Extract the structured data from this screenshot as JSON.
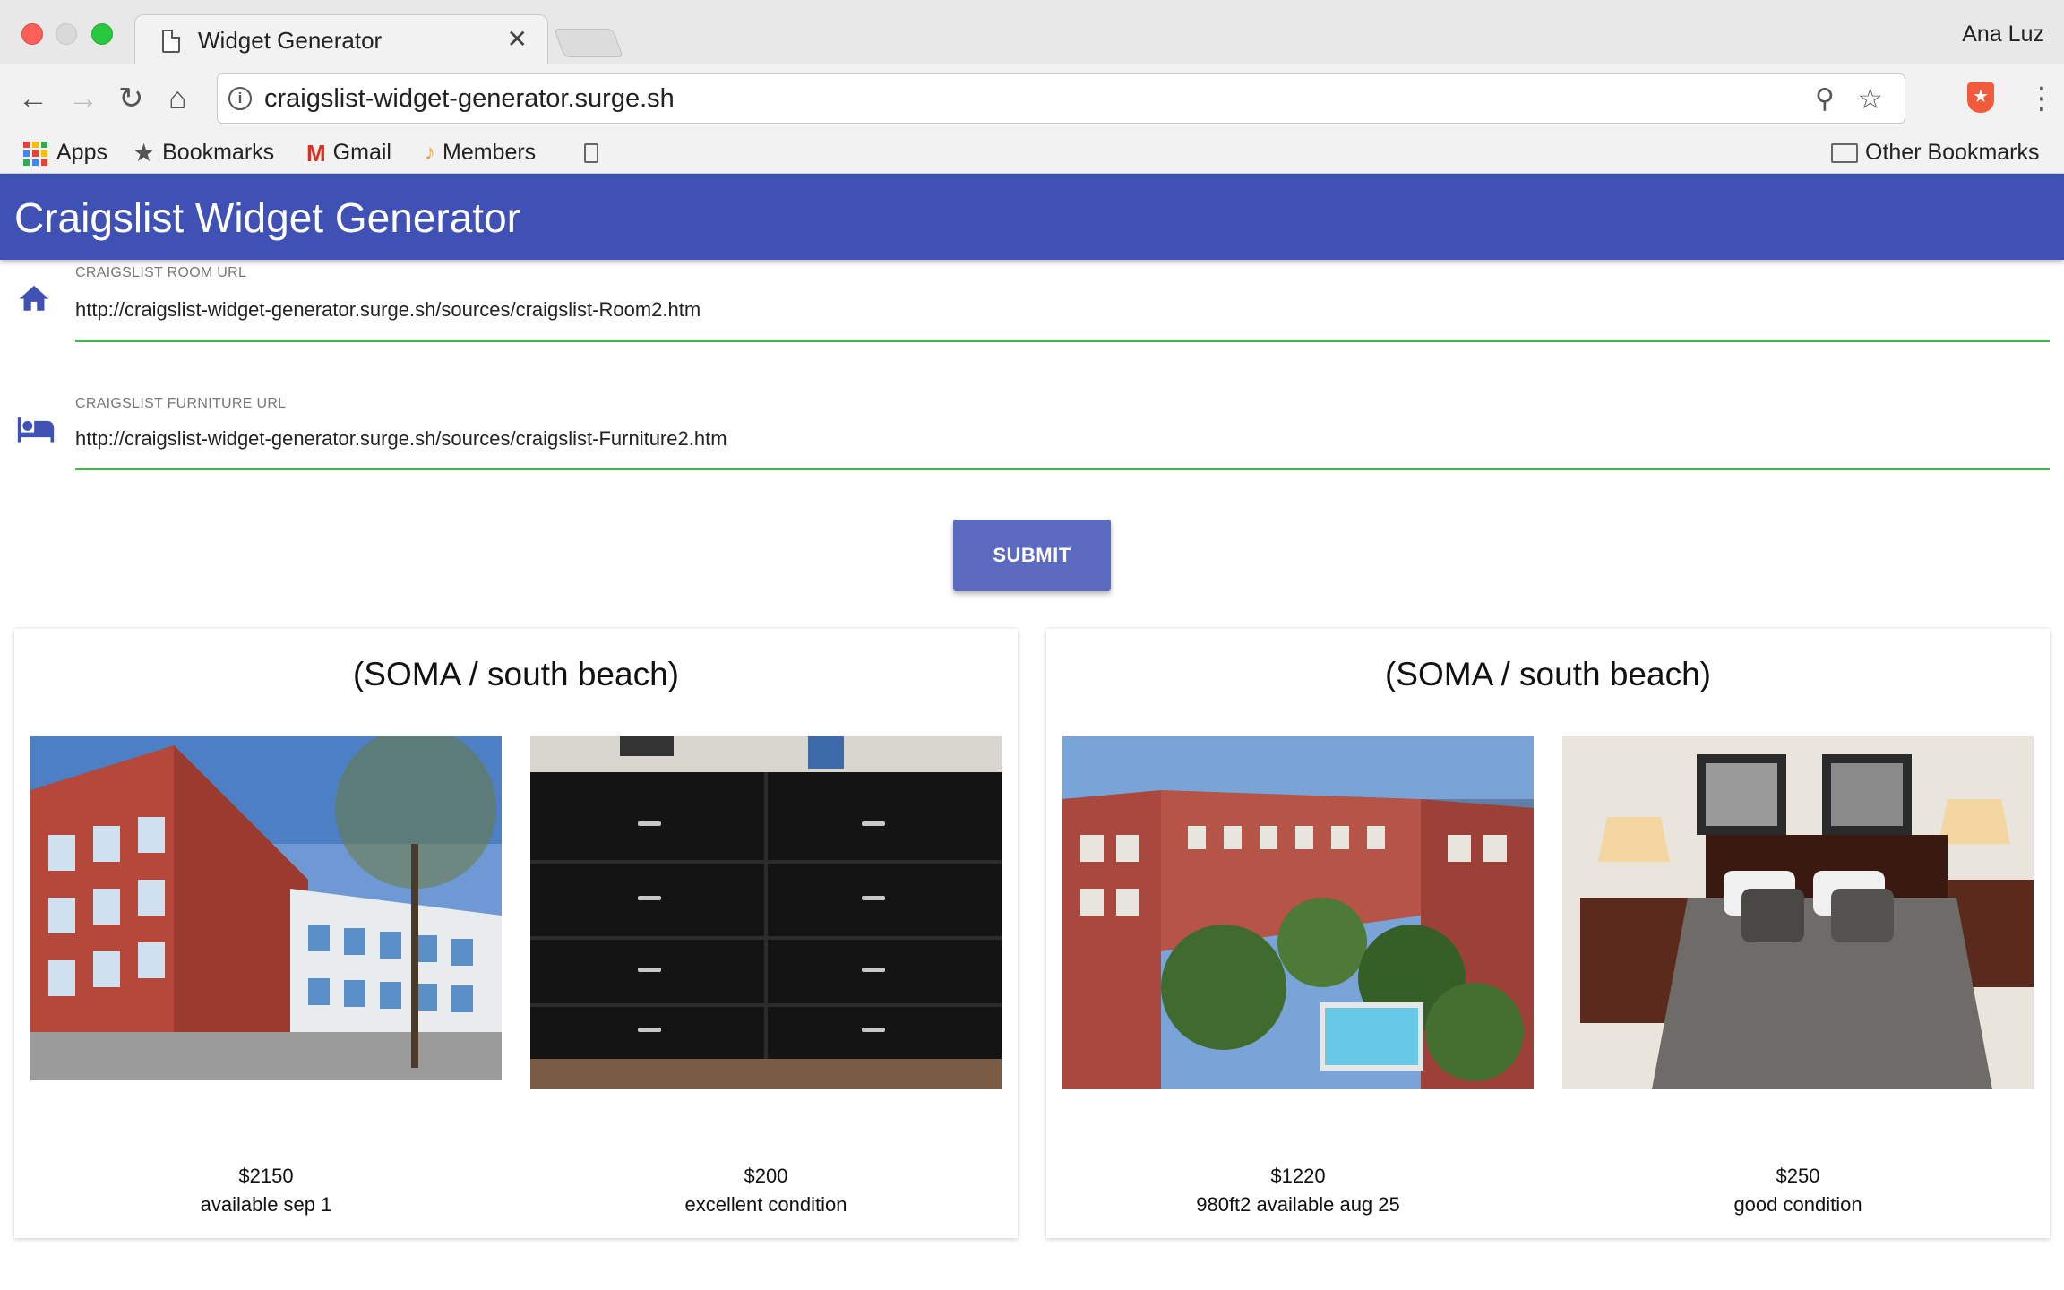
{
  "browser": {
    "tab_title": "Widget Generator",
    "profile_name": "Ana Luz",
    "url": "craigslist-widget-generator.surge.sh",
    "bookmarks": [
      "Apps",
      "Bookmarks",
      "Gmail",
      "Members"
    ],
    "other_bookmarks": "Other Bookmarks"
  },
  "app": {
    "title": "Craigslist Widget Generator",
    "accent_color": "#3f51b5",
    "room_field": {
      "label": "CRAIGSLIST ROOM URL",
      "value": "http://craigslist-widget-generator.surge.sh/sources/craigslist-Room2.htm",
      "icon": "home-icon"
    },
    "furniture_field": {
      "label": "CRAIGSLIST FURNITURE URL",
      "value": "http://craigslist-widget-generator.surge.sh/sources/craigslist-Furniture2.htm",
      "icon": "bed-icon"
    },
    "submit_label": "SUBMIT"
  },
  "cards": [
    {
      "title": "(SOMA / south beach)",
      "items": [
        {
          "price": "$2150",
          "desc": "available sep 1",
          "photo": "apartment-building-photo"
        },
        {
          "price": "$200",
          "desc": "excellent condition",
          "photo": "black-dresser-photo"
        }
      ]
    },
    {
      "title": "(SOMA / south beach)",
      "items": [
        {
          "price": "$1220",
          "desc": "980ft2 available aug 25",
          "photo": "courtyard-pool-photo"
        },
        {
          "price": "$250",
          "desc": "good condition",
          "photo": "bedroom-photo"
        }
      ]
    }
  ]
}
